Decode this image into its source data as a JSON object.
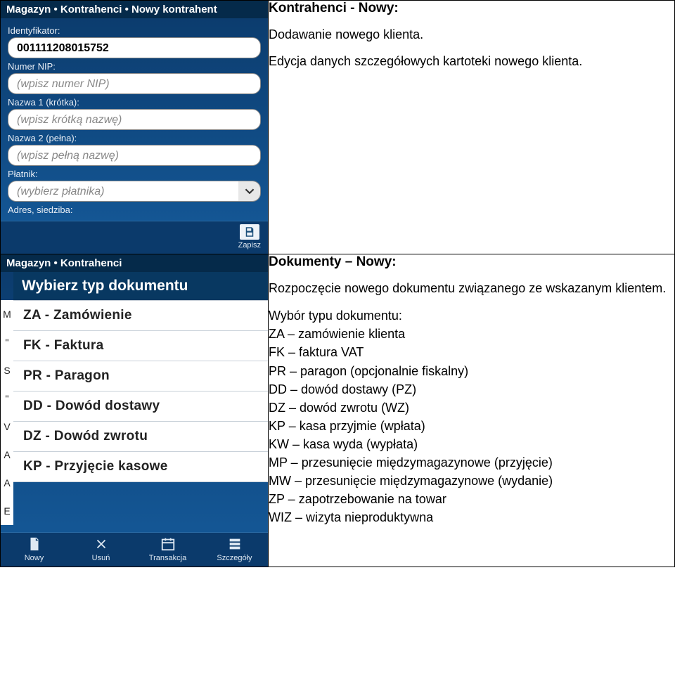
{
  "row1": {
    "phone": {
      "breadcrumb": "Magazyn • Kontrahenci • Nowy kontrahent",
      "fields": {
        "id_label": "Identyfikator:",
        "id_value": "001111208015752",
        "nip_label": "Numer NIP:",
        "nip_placeholder": "(wpisz numer NIP)",
        "name1_label": "Nazwa 1 (krótka):",
        "name1_placeholder": "(wpisz krótką nazwę)",
        "name2_label": "Nazwa 2 (pełna):",
        "name2_placeholder": "(wpisz pełną nazwę)",
        "payer_label": "Płatnik:",
        "payer_placeholder": "(wybierz płatnika)",
        "address_label": "Adres, siedziba:"
      },
      "save_label": "Zapisz"
    },
    "doc": {
      "title": "Kontrahenci - Nowy:",
      "p1": "Dodawanie nowego klienta.",
      "p2": "Edycja danych szczegółowych kartoteki nowego klienta."
    }
  },
  "row2": {
    "phone": {
      "breadcrumb": "Magazyn • Kontrahenci",
      "banner": "Wybierz typ dokumentu",
      "items": [
        "ZA - Zamówienie",
        "FK - Faktura",
        "PR - Paragon",
        "DD - Dowód dostawy",
        "DZ - Dowód zwrotu",
        "KP - Przyjęcie kasowe"
      ],
      "side": [
        "M",
        "\"",
        "S",
        "\"",
        "V",
        "A",
        "A",
        "E"
      ],
      "bottom": {
        "new": "Nowy",
        "del": "Usuń",
        "trx": "Transakcja",
        "det": "Szczegóły"
      }
    },
    "doc": {
      "title": "Dokumenty – Nowy:",
      "p1": "Rozpoczęcie nowego dokumentu związanego ze wskazanym klientem.",
      "list_intro": "Wybór typu dokumentu:",
      "items": [
        "ZA – zamówienie klienta",
        "FK – faktura VAT",
        "PR – paragon (opcjonalnie fiskalny)",
        "DD – dowód dostawy (PZ)",
        "DZ – dowód zwrotu (WZ)",
        "KP – kasa przyjmie (wpłata)",
        "KW – kasa wyda (wypłata)",
        "MP – przesunięcie międzymagazynowe (przyjęcie)",
        "MW – przesunięcie międzymagazynowe (wydanie)",
        "ZP – zapotrzebowanie na towar",
        "WIZ – wizyta nieproduktywna"
      ]
    }
  }
}
